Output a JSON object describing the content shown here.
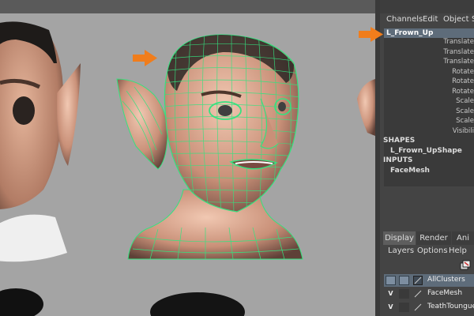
{
  "channel_box": {
    "menus": [
      "Channels",
      "Edit",
      "Object",
      "S"
    ],
    "object_name": "L_Frown_Up",
    "attributes": [
      "Translate",
      "Translate",
      "Translate",
      "Rotate",
      "Rotate",
      "Rotate",
      "Scale",
      "Scale",
      "Scale",
      "Visibili"
    ],
    "shapes_label": "SHAPES",
    "shape_node": "L_Frown_UpShape",
    "inputs_label": "INPUTS",
    "input_node": "FaceMesh"
  },
  "layer_editor": {
    "tabs": [
      "Display",
      "Render",
      "Ani"
    ],
    "menus": [
      "Layers",
      "Options",
      "Help"
    ],
    "layers": [
      {
        "visibility": "",
        "name": "AllClusters",
        "selected": true
      },
      {
        "visibility": "V",
        "name": "FaceMesh",
        "selected": false
      },
      {
        "visibility": "V",
        "name": "TeathToungueE",
        "selected": false
      }
    ]
  },
  "colors": {
    "viewport_bg": "#a4a4a4",
    "wireframe": "#35e27f",
    "annotation_arrow": "#f07d1c",
    "selection": "#5e6c7a",
    "skin": "#d9a48a"
  }
}
